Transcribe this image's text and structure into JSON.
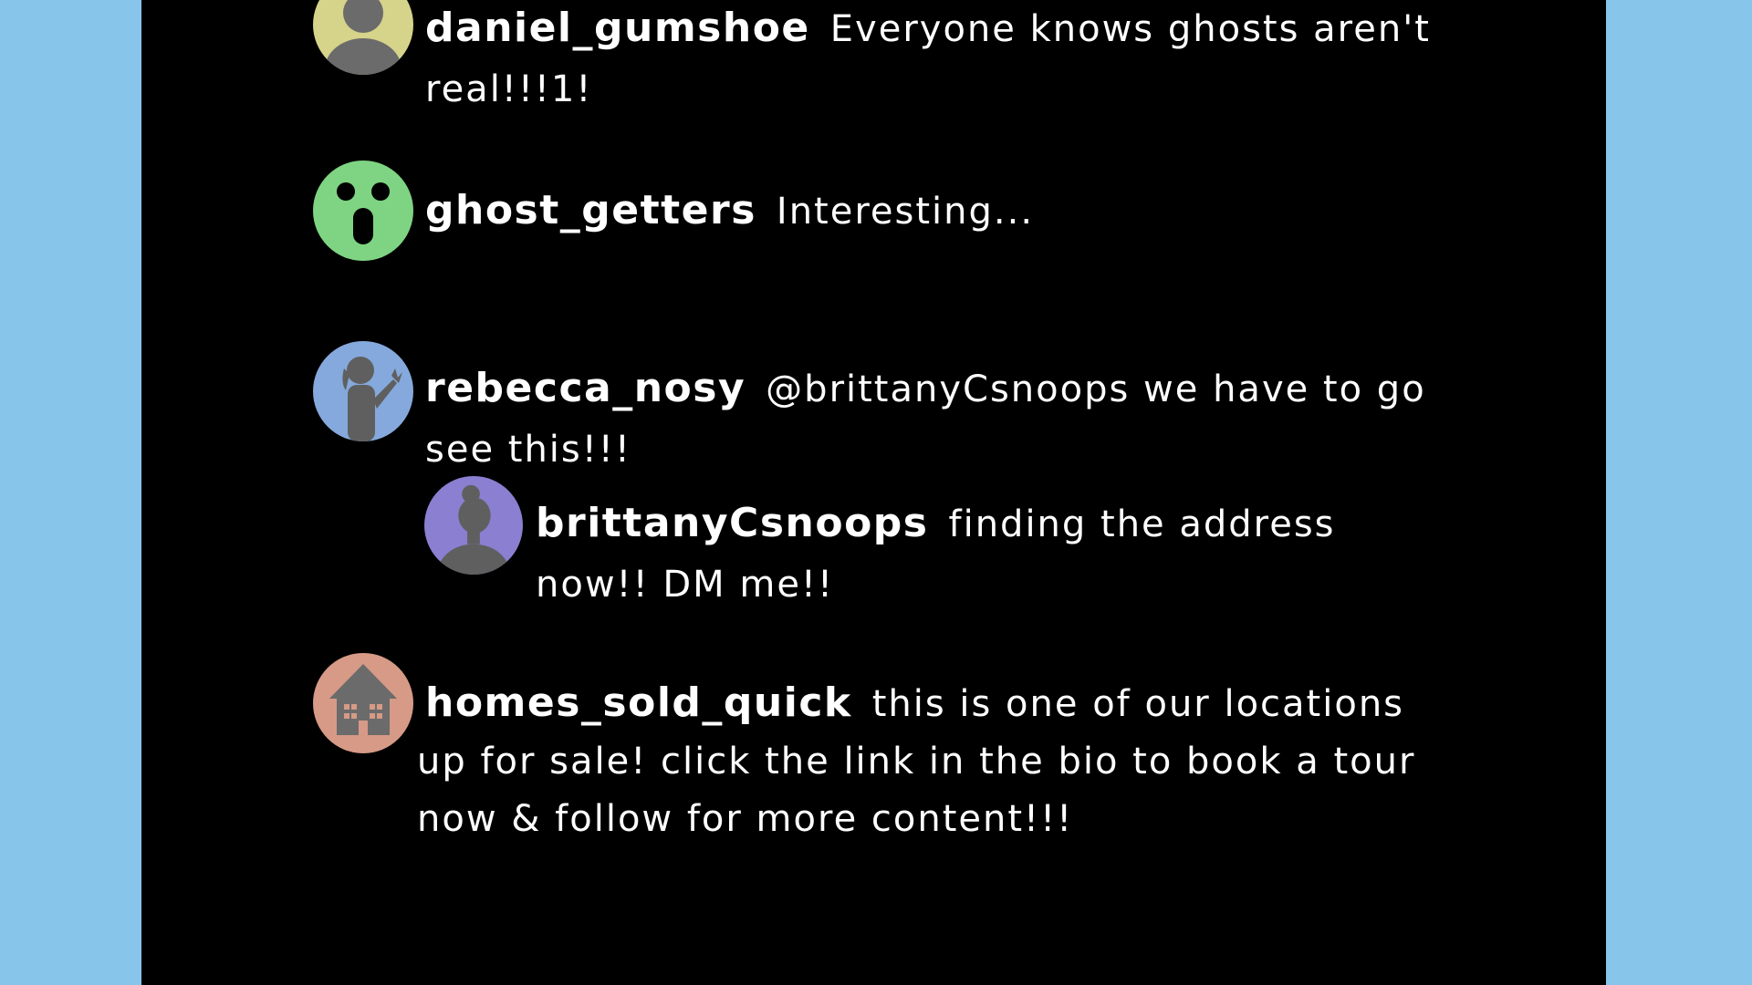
{
  "colors": {
    "background": "#87c6ea",
    "panel": "#000000",
    "text": "#ffffff",
    "avatar_silhouette": "#6b6b6b"
  },
  "comments": [
    {
      "username": "daniel_gumshoe",
      "message": "Everyone knows ghosts aren't real!!!1!",
      "avatar_icon": "person-silhouette-icon",
      "avatar_color": "#d6d38a"
    },
    {
      "username": "ghost_getters",
      "message": "Interesting...",
      "avatar_icon": "surprised-face-icon",
      "avatar_color": "#7ed482"
    },
    {
      "username": "rebecca_nosy",
      "message": "@brittanyCsnoops we have to go see this!!!",
      "avatar_icon": "woman-waving-icon",
      "avatar_color": "#85a9dc",
      "replies": [
        {
          "username": "brittanyCsnoops",
          "message": "finding the address now!! DM me!!",
          "avatar_icon": "woman-profile-icon",
          "avatar_color": "#8a7fd0"
        }
      ]
    },
    {
      "username": "homes_sold_quick",
      "message": "this is one of our locations up for sale! click the link in the bio to book a tour now & follow for more content!!!",
      "avatar_icon": "house-icon",
      "avatar_color": "#d69a86"
    }
  ]
}
